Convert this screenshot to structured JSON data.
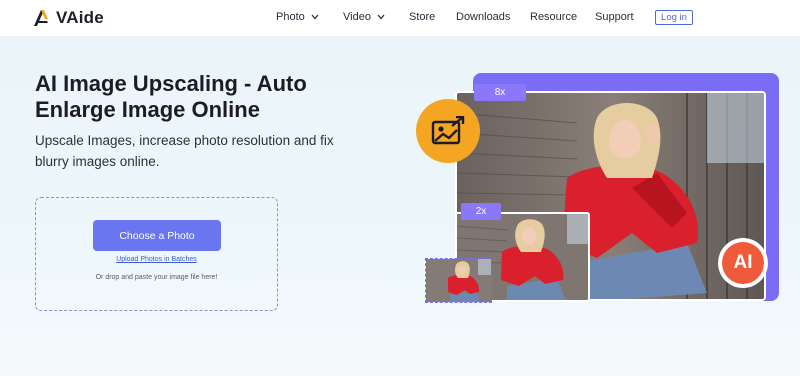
{
  "brand": {
    "name": "VAide",
    "accent": "#6a76ef",
    "orange": "#f4a623",
    "purple": "#7b6cf6"
  },
  "nav": {
    "items": [
      {
        "label": "Photo",
        "has_dropdown": true
      },
      {
        "label": "Video",
        "has_dropdown": true
      },
      {
        "label": "Store",
        "has_dropdown": false
      },
      {
        "label": "Downloads",
        "has_dropdown": false
      },
      {
        "label": "Resource",
        "has_dropdown": false
      },
      {
        "label": "Support",
        "has_dropdown": false
      }
    ],
    "login_label": "Log in"
  },
  "hero": {
    "title": "AI Image Upscaling - Auto Enlarge Image Online",
    "subtitle": "Upscale Images, increase photo resolution and fix blurry images online."
  },
  "upload": {
    "choose_label": "Choose a Photo",
    "batch_label": "Upload Photos in Batches",
    "drop_text": "Or drop and paste your image file here!"
  },
  "illustration": {
    "tag_large": "8x",
    "tag_small": "2x",
    "ai_badge": "AI",
    "icons": [
      "upscale-image-icon"
    ]
  }
}
